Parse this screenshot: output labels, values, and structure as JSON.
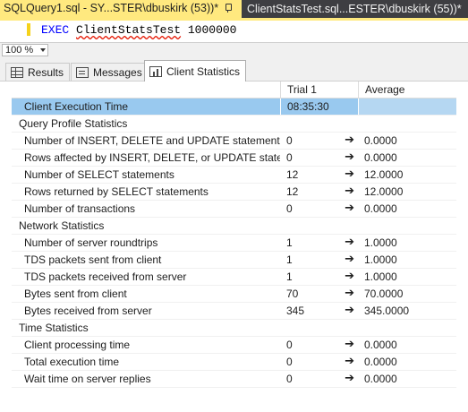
{
  "doc_tabs": [
    {
      "title": "SQLQuery1.sql - SY...STER\\dbuskirk (53))*",
      "active": true
    },
    {
      "title": "ClientStatsTest.sql...ESTER\\dbuskirk (55))*",
      "active": false
    }
  ],
  "editor": {
    "keyword": "EXEC",
    "procedure": "ClientStatsTest",
    "argument": "1000000"
  },
  "zoom": {
    "value": "100 %"
  },
  "result_tabs": [
    {
      "label": "Results",
      "icon": "grid-icon"
    },
    {
      "label": "Messages",
      "icon": "messages-icon"
    },
    {
      "label": "Client Statistics",
      "icon": "statistics-icon",
      "active": true
    }
  ],
  "grid": {
    "headers": {
      "trial": "Trial  1",
      "average": "Average"
    },
    "rows": [
      {
        "type": "item",
        "selected": true,
        "name": "Client Execution Time",
        "trial": "08:35:30",
        "average": ""
      },
      {
        "type": "group",
        "name": "Query Profile Statistics"
      },
      {
        "type": "item",
        "name": "Number of INSERT, DELETE and UPDATE statements",
        "trial": "0",
        "average": "0.0000"
      },
      {
        "type": "item",
        "name": "Rows affected by INSERT, DELETE, or UPDATE statem...",
        "trial": "0",
        "average": "0.0000"
      },
      {
        "type": "item",
        "name": "Number of SELECT statements",
        "trial": "12",
        "average": "12.0000"
      },
      {
        "type": "item",
        "name": "Rows returned by SELECT statements",
        "trial": "12",
        "average": "12.0000"
      },
      {
        "type": "item",
        "name": "Number of transactions",
        "trial": "0",
        "average": "0.0000"
      },
      {
        "type": "group",
        "name": "Network Statistics"
      },
      {
        "type": "item",
        "name": "Number of server roundtrips",
        "trial": "1",
        "average": "1.0000"
      },
      {
        "type": "item",
        "name": "TDS packets sent from client",
        "trial": "1",
        "average": "1.0000"
      },
      {
        "type": "item",
        "name": "TDS packets received from server",
        "trial": "1",
        "average": "1.0000"
      },
      {
        "type": "item",
        "name": "Bytes sent from client",
        "trial": "70",
        "average": "70.0000"
      },
      {
        "type": "item",
        "name": "Bytes received from server",
        "trial": "345",
        "average": "345.0000"
      },
      {
        "type": "group",
        "name": "Time Statistics"
      },
      {
        "type": "item",
        "name": "Client processing time",
        "trial": "0",
        "average": "0.0000"
      },
      {
        "type": "item",
        "name": "Total execution time",
        "trial": "0",
        "average": "0.0000"
      },
      {
        "type": "item",
        "name": "Wait time on server replies",
        "trial": "0",
        "average": "0.0000"
      }
    ]
  },
  "colors": {
    "active_tab": "#ffe97f",
    "selected_row": "#99c9ef",
    "keyword": "#0000ff"
  }
}
